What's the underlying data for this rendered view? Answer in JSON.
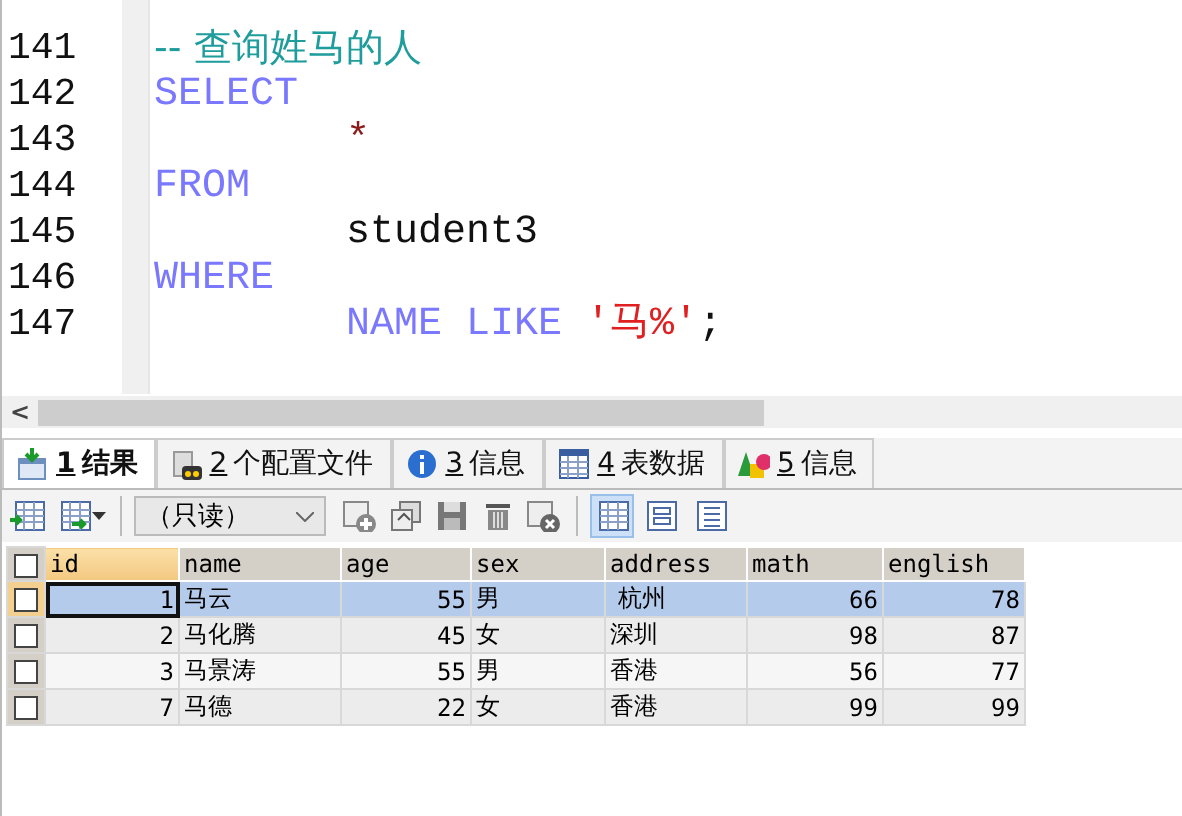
{
  "editor": {
    "lines": [
      {
        "number": "141",
        "segments": [
          {
            "kind": "comment",
            "text": "-- 查询姓马的人"
          }
        ]
      },
      {
        "number": "142",
        "segments": [
          {
            "kind": "keyword",
            "text": "SELECT"
          }
        ]
      },
      {
        "number": "143",
        "segments": [
          {
            "kind": "operator",
            "text": "        *"
          }
        ]
      },
      {
        "number": "144",
        "segments": [
          {
            "kind": "keyword",
            "text": "FROM"
          }
        ]
      },
      {
        "number": "145",
        "segments": [
          {
            "kind": "plain",
            "text": "        student3"
          }
        ]
      },
      {
        "number": "146",
        "segments": [
          {
            "kind": "keyword",
            "text": "WHERE"
          }
        ]
      },
      {
        "number": "147",
        "segments": [
          {
            "kind": "keyword",
            "text": "        NAME LIKE"
          },
          {
            "kind": "string",
            "text": "'马%'"
          },
          {
            "kind": "plain",
            "text": ";"
          }
        ]
      }
    ]
  },
  "scrollbar": {
    "arrow": "<"
  },
  "tabs": [
    {
      "number": "1",
      "label": "结果",
      "selected": true
    },
    {
      "number": "2",
      "label": "个配置文件",
      "selected": false
    },
    {
      "number": "3",
      "label": "信息",
      "selected": false
    },
    {
      "number": "4",
      "label": "表数据",
      "selected": false
    },
    {
      "number": "5",
      "label": "信息",
      "selected": false
    }
  ],
  "toolbar": {
    "dropdown": {
      "value": "（只读）"
    },
    "views": [
      {
        "selected": true
      },
      {
        "selected": false
      },
      {
        "selected": false
      }
    ]
  },
  "table": {
    "all_checked": false,
    "columns": [
      "id",
      "name",
      "age",
      "sex",
      "address",
      "math",
      "english"
    ],
    "rows": [
      {
        "cells": [
          "1",
          "马云",
          "55",
          "男",
          " 杭州",
          "66",
          "78"
        ],
        "selected": true,
        "checked": false
      },
      {
        "cells": [
          "2",
          "马化腾",
          "45",
          "女",
          "深圳",
          "98",
          "87"
        ],
        "selected": false,
        "checked": false
      },
      {
        "cells": [
          "3",
          "马景涛",
          "55",
          "男",
          "香港",
          "56",
          "77"
        ],
        "selected": false,
        "checked": false
      },
      {
        "cells": [
          "7",
          "马德",
          "22",
          "女",
          "香港",
          "99",
          "99"
        ],
        "selected": false,
        "checked": false
      }
    ]
  }
}
